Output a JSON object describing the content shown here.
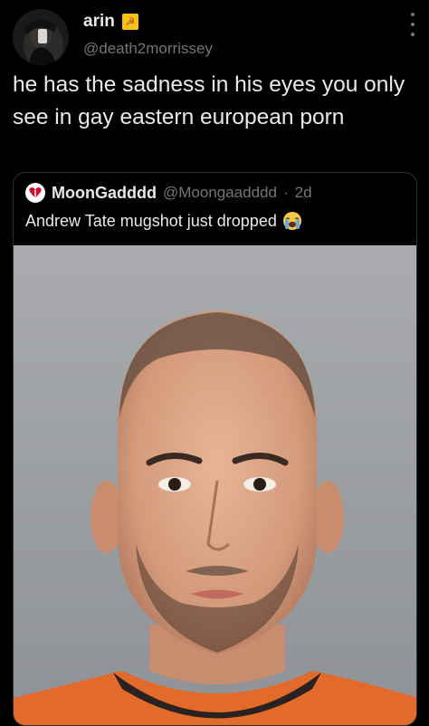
{
  "tweet": {
    "display_name": "arin",
    "handle": "@death2morrissey",
    "text": "he has the sadness in his eyes you only see in gay eastern european porn",
    "badge_icon": "hammer-sickle-flag-icon"
  },
  "quoted_tweet": {
    "display_name": "MoonGadddd",
    "handle": "@Moongaadddd",
    "separator": "·",
    "time": "2d",
    "text": "Andrew Tate mugshot just dropped",
    "emoji_icon": "loudly-crying-face-icon",
    "media": "mugshot-photo"
  },
  "colors": {
    "background": "#000000",
    "primary_text": "#e7e9ea",
    "secondary_text": "#71767b",
    "border": "#2f3336"
  }
}
